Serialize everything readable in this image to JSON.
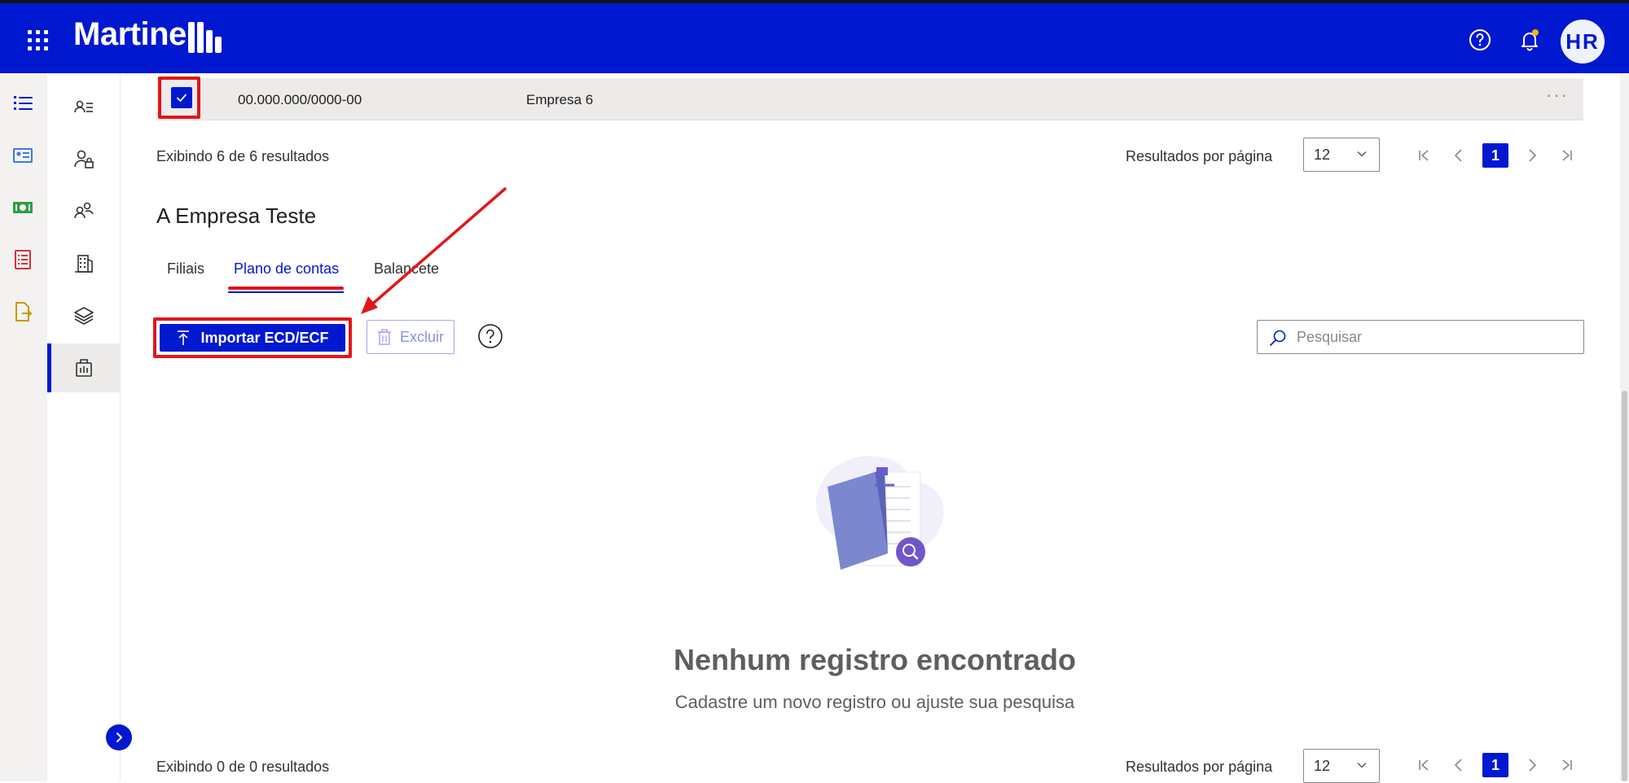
{
  "header": {
    "brand": "Martinelli",
    "brand_text": "Martine",
    "avatar_initials": "HR",
    "accent_color": "#0018d0",
    "icons": [
      "waffle-icon",
      "help-icon",
      "bell-icon"
    ]
  },
  "rail": {
    "icons": [
      "list-icon",
      "id-card-icon",
      "money-icon",
      "checklist-icon",
      "file-export-icon"
    ]
  },
  "subnav": {
    "icons": [
      "user-list-icon",
      "user-lock-icon",
      "users-icon",
      "building-icon",
      "layers-icon",
      "briefcase-icon"
    ],
    "active_index": 5
  },
  "top_table": {
    "row": {
      "cnpj": "00.000.000/0000-00",
      "name": "Empresa 6",
      "checked": true,
      "more": "···"
    },
    "results_text": "Exibindo 6 de 6 resultados",
    "rpp_label": "Resultados por página",
    "rpp_value": "12",
    "current_page": "1"
  },
  "section": {
    "title": "A Empresa Teste",
    "tabs": [
      {
        "label": "Filiais",
        "active": false
      },
      {
        "label": "Plano de contas",
        "active": true
      },
      {
        "label": "Balancete",
        "active": false
      }
    ]
  },
  "toolbar": {
    "import_label": "Importar ECD/ECF",
    "delete_label": "Excluir",
    "search_placeholder": "Pesquisar"
  },
  "empty_state": {
    "title": "Nenhum registro encontrado",
    "subtitle": "Cadastre um novo registro ou ajuste sua pesquisa"
  },
  "bottom_table": {
    "results_text": "Exibindo 0 de 0 resultados",
    "rpp_label": "Resultados por página",
    "rpp_value": "12",
    "current_page": "1"
  },
  "annotation_color": "#e0161b"
}
